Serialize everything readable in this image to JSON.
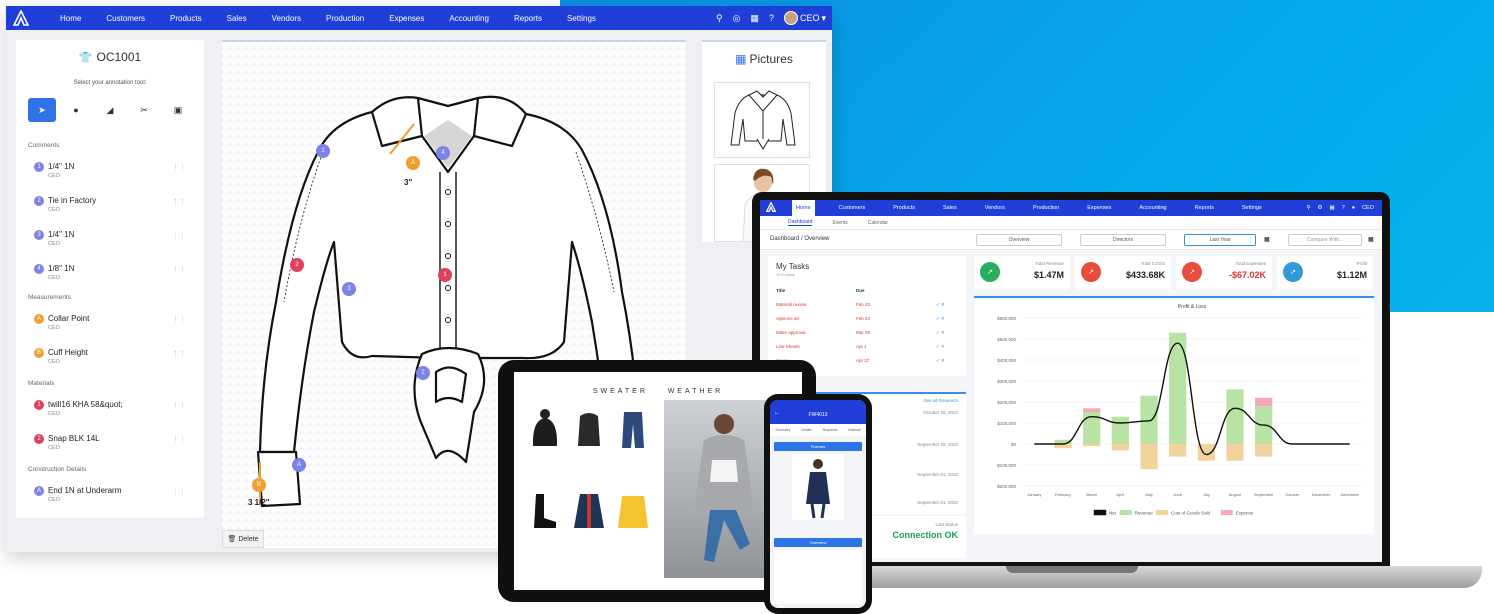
{
  "colors": {
    "nav": "#1f3fd8",
    "accent": "#2f73e8",
    "background": "#04a9ea",
    "success": "#1a9f4c",
    "danger": "#d33333"
  },
  "desktop": {
    "nav": {
      "logo": "A",
      "items": [
        "Home",
        "Customers",
        "Products",
        "Sales",
        "Vendors",
        "Production",
        "Expenses",
        "Accounting",
        "Reports",
        "Settings"
      ],
      "icons": [
        "search-icon",
        "globe-icon",
        "grid-icon",
        "help-icon"
      ],
      "user": "CEO"
    },
    "annotator": {
      "title": "OC1001",
      "subtitle": "Select your annotation tool:",
      "tools": [
        "pointer-icon",
        "comment-icon",
        "angle-icon",
        "scissors-icon",
        "note-icon"
      ],
      "sections": [
        {
          "label": "Comments",
          "items": [
            {
              "num": "1",
              "name": "1/4\" 1N",
              "by": "CEO"
            },
            {
              "num": "2",
              "name": "Tie in Factory",
              "by": "CEO"
            },
            {
              "num": "3",
              "name": "1/4\" 1N",
              "by": "CEO"
            },
            {
              "num": "4",
              "name": "1/8\" 1N",
              "by": "CEO"
            }
          ]
        },
        {
          "label": "Measurements",
          "items": [
            {
              "num": "A",
              "name": "Collar Point",
              "by": "CEO"
            },
            {
              "num": "B",
              "name": "Cuff Height",
              "by": "CEO"
            }
          ]
        },
        {
          "label": "Materials",
          "items": [
            {
              "num": "1",
              "name": "twill16 KHA 58&quot;",
              "by": "CEO"
            },
            {
              "num": "2",
              "name": "Snap BLK 14L",
              "by": "CEO"
            }
          ]
        },
        {
          "label": "Construction Details",
          "items": [
            {
              "num": "A",
              "name": "End 1N at Underarm",
              "by": "CEO"
            }
          ]
        }
      ]
    },
    "canvas": {
      "measure_a": "3\"",
      "measure_b": "3 1/2\"",
      "markers": [
        "1",
        "2",
        "3",
        "4",
        "A",
        "B",
        "1",
        "2",
        "A"
      ]
    },
    "delete_label": "Delete",
    "pictures_title": "Pictures"
  },
  "laptop": {
    "nav": {
      "items": [
        "Home",
        "Customers",
        "Products",
        "Sales",
        "Vendors",
        "Production",
        "Expenses",
        "Accounting",
        "Reports",
        "Settings"
      ],
      "user": "CEO"
    },
    "subtabs": [
      "Dashboard",
      "Events",
      "Calendar"
    ],
    "breadcrumb": "Dashboard / Overview",
    "view_buttons": [
      "Overview",
      "Directors",
      "Last Year",
      "Compare With..."
    ],
    "tasks": {
      "title": "My Tasks",
      "subtitle": "10 in week",
      "col_title": "Title",
      "col_due": "Due",
      "rows": [
        {
          "title": "Material review",
          "due": "Feb 23"
        },
        {
          "title": "Approve art",
          "due": "Feb 23"
        },
        {
          "title": "Make approval",
          "due": "Mar 29"
        },
        {
          "title": "Line Sheets",
          "due": "Apr 1"
        },
        {
          "title": "Specs",
          "due": "Apr 27"
        }
      ]
    },
    "events": {
      "link": "See all Research",
      "dates": [
        "October 26, 2022",
        "September 29, 2022",
        "September 01, 2022",
        "September 01, 2022"
      ]
    },
    "connection": {
      "label": "Last Status",
      "value": "Connection OK"
    },
    "kpis": [
      {
        "label": "Total Revenue",
        "value": "$1.47M",
        "color": "#27ae60"
      },
      {
        "label": "Total COGS",
        "value": "$433.68K",
        "color": "#e74c3c"
      },
      {
        "label": "Total Expenses",
        "value": "-$67.02K",
        "color": "#e74c3c"
      },
      {
        "label": "Profit",
        "value": "$1.12M",
        "color": "#3498db"
      }
    ]
  },
  "chart_data": {
    "type": "bar",
    "title": "Profit & Loss",
    "categories": [
      "January",
      "February",
      "March",
      "April",
      "May",
      "June",
      "July",
      "August",
      "September",
      "October",
      "November",
      "December"
    ],
    "ylim": [
      -200000,
      600000
    ],
    "yticks": [
      "$600,000",
      "$500,000",
      "$400,000",
      "$300,000",
      "$200,000",
      "$100,000",
      "$0",
      "-$100,000",
      "-$200,000"
    ],
    "series": [
      {
        "name": "Revenue",
        "color": "#b9e3a4",
        "values": [
          0,
          20000,
          150000,
          130000,
          230000,
          530000,
          0,
          260000,
          180000,
          0,
          0,
          0
        ]
      },
      {
        "name": "Cost of Goods Sold",
        "color": "#f3d39c",
        "values": [
          0,
          -20000,
          -10000,
          -30000,
          -120000,
          -60000,
          -80000,
          -80000,
          -60000,
          0,
          0,
          0
        ]
      },
      {
        "name": "Expense",
        "color": "#f4a9b4",
        "values": [
          0,
          0,
          20000,
          0,
          0,
          0,
          0,
          0,
          40000,
          0,
          0,
          0
        ]
      },
      {
        "name": "Net",
        "color": "#111111",
        "values": [
          0,
          0,
          130000,
          100000,
          110000,
          480000,
          -50000,
          170000,
          90000,
          0,
          0,
          0
        ]
      }
    ],
    "legend_position": "bottom"
  },
  "tablet": {
    "brand_left": "SWEATER",
    "brand_right": "WEATHER"
  },
  "phone": {
    "title": "FW4013",
    "tabs": [
      "Summary",
      "Details",
      "Requests",
      "Material"
    ],
    "button_pictures": "Pictures",
    "button_overview": "Overview"
  }
}
